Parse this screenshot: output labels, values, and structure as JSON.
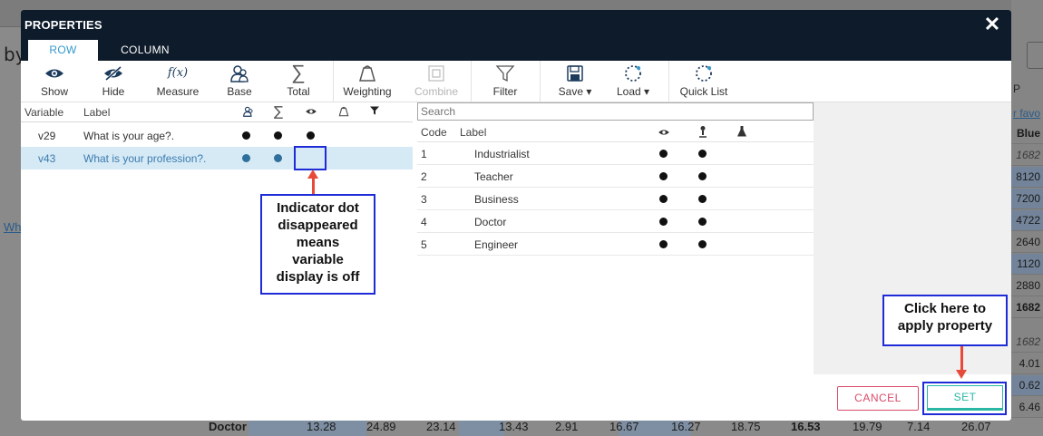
{
  "background": {
    "by_text": "by",
    "wh_link": "Wh",
    "right_header": "P",
    "right_fav": "r favo",
    "right_cells": [
      {
        "v": "Blue",
        "style": "bold"
      },
      {
        "v": "1682",
        "style": "it"
      },
      {
        "v": "8120",
        "style": "blue"
      },
      {
        "v": "7200",
        "style": "blue"
      },
      {
        "v": "4722",
        "style": "blue"
      },
      {
        "v": "2640",
        "style": ""
      },
      {
        "v": "1120",
        "style": "blue"
      },
      {
        "v": "2880",
        "style": ""
      },
      {
        "v": "1682",
        "style": "bold"
      }
    ],
    "right_cells_lower": [
      {
        "v": "1682",
        "style": "it"
      },
      {
        "v": "4.01",
        "style": ""
      },
      {
        "v": "0.62",
        "style": "blue"
      },
      {
        "v": "6.46",
        "style": ""
      }
    ],
    "bottom_row": {
      "label": "Doctor",
      "values": [
        "13.28",
        "24.89",
        "23.14",
        "13.43",
        "2.91",
        "16.67",
        "16.27",
        "18.75",
        "16.53",
        "19.79",
        "7.14",
        "26.07"
      ]
    }
  },
  "modal": {
    "title": "PROPERTIES",
    "close": "✕",
    "tabs": [
      {
        "label": "ROW",
        "active": true
      },
      {
        "label": "COLUMN",
        "active": false
      }
    ],
    "toolbar": {
      "show": "Show",
      "hide": "Hide",
      "measure": "Measure",
      "measure_icon_text": "f(x)",
      "base": "Base",
      "total": "Total",
      "weighting": "Weighting",
      "combine": "Combine",
      "filter": "Filter",
      "save": "Save ▾",
      "load": "Load ▾",
      "quick_list": "Quick List"
    },
    "variables": {
      "headers": {
        "variable": "Variable",
        "label": "Label"
      },
      "rows": [
        {
          "variable": "v29",
          "label": "What is your age?.",
          "base": true,
          "total": true,
          "show": true,
          "selected": false
        },
        {
          "variable": "v43",
          "label": "What is your profession?.",
          "base": true,
          "total": true,
          "show": false,
          "selected": true
        }
      ]
    },
    "codes": {
      "search_placeholder": "Search",
      "headers": {
        "code": "Code",
        "label": "Label"
      },
      "rows": [
        {
          "code": "1",
          "label": "Industrialist"
        },
        {
          "code": "2",
          "label": "Teacher"
        },
        {
          "code": "3",
          "label": "Business"
        },
        {
          "code": "4",
          "label": "Doctor"
        },
        {
          "code": "5",
          "label": "Engineer"
        }
      ]
    },
    "buttons": {
      "cancel": "CANCEL",
      "set": "SET"
    }
  },
  "callouts": {
    "indicator": [
      "Indicator dot",
      "disappeared",
      "means",
      "variable",
      "display is off"
    ],
    "set": [
      "Click here to",
      "apply property"
    ]
  },
  "colors": {
    "header_bg": "#0d1b2a",
    "tab_active_text": "#3399cc",
    "selected_row_bg": "#d6eaf5",
    "callout_border": "#1e2bd6",
    "arrow": "#e84a3a",
    "cancel": "#d94b6a",
    "set": "#2ab8a4"
  }
}
